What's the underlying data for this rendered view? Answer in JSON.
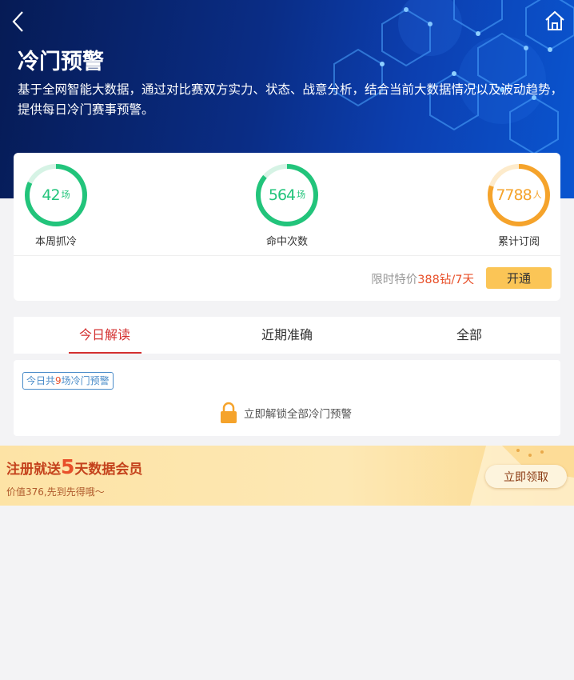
{
  "header": {
    "title": "冷门预警",
    "description": "基于全网智能大数据，通过对比赛双方实力、状态、战意分析，结合当前大数据情况以及波动趋势，提供每日冷门赛事预警。",
    "back_icon": "chevron-left-icon",
    "home_icon": "home-icon"
  },
  "stats": [
    {
      "value": "42",
      "unit": "场",
      "label": "本周抓冷",
      "color": "#22c47b",
      "progress": 0.82
    },
    {
      "value": "564",
      "unit": "场",
      "label": "命中次数",
      "color": "#22c47b",
      "progress": 0.86
    },
    {
      "value": "7788",
      "unit": "人",
      "label": "累计订阅",
      "color": "#f5a32b",
      "progress": 0.8
    }
  ],
  "promo": {
    "prefix": "限时特价",
    "price": "388钻/7天",
    "button": "开通"
  },
  "tabs": [
    {
      "label": "今日解读",
      "active": true
    },
    {
      "label": "近期准确",
      "active": false
    },
    {
      "label": "全部",
      "active": false
    }
  ],
  "content": {
    "badge_prefix": "今日共",
    "badge_count": "9",
    "badge_suffix": "场冷门预警",
    "unlock_text": "立即解锁全部冷门预警",
    "lock_icon": "lock-icon"
  },
  "banner": {
    "title_prefix": "注册就送",
    "title_big": "5",
    "title_suffix": "天数据会员",
    "subtitle": "价值376,先到先得哦～",
    "button": "立即领取"
  },
  "colors": {
    "accent_red": "#d32f2f",
    "price_red": "#e8502a",
    "green": "#22c47b",
    "orange": "#f5a32b",
    "button_yellow": "#fbc556"
  }
}
